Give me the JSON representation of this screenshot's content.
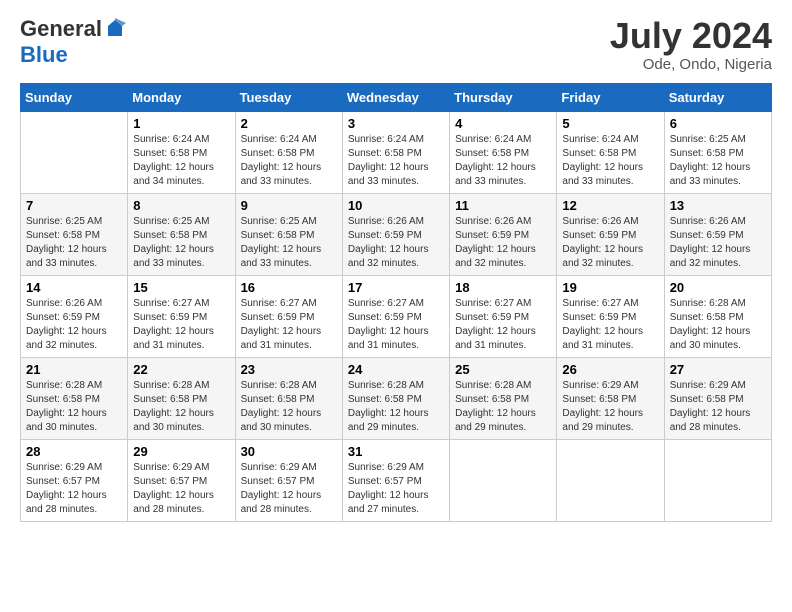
{
  "header": {
    "logo_general": "General",
    "logo_blue": "Blue",
    "month_year": "July 2024",
    "location": "Ode, Ondo, Nigeria"
  },
  "days_of_week": [
    "Sunday",
    "Monday",
    "Tuesday",
    "Wednesday",
    "Thursday",
    "Friday",
    "Saturday"
  ],
  "weeks": [
    [
      {
        "day": "",
        "sunrise": "",
        "sunset": "",
        "daylight": ""
      },
      {
        "day": "1",
        "sunrise": "Sunrise: 6:24 AM",
        "sunset": "Sunset: 6:58 PM",
        "daylight": "Daylight: 12 hours and 34 minutes."
      },
      {
        "day": "2",
        "sunrise": "Sunrise: 6:24 AM",
        "sunset": "Sunset: 6:58 PM",
        "daylight": "Daylight: 12 hours and 33 minutes."
      },
      {
        "day": "3",
        "sunrise": "Sunrise: 6:24 AM",
        "sunset": "Sunset: 6:58 PM",
        "daylight": "Daylight: 12 hours and 33 minutes."
      },
      {
        "day": "4",
        "sunrise": "Sunrise: 6:24 AM",
        "sunset": "Sunset: 6:58 PM",
        "daylight": "Daylight: 12 hours and 33 minutes."
      },
      {
        "day": "5",
        "sunrise": "Sunrise: 6:24 AM",
        "sunset": "Sunset: 6:58 PM",
        "daylight": "Daylight: 12 hours and 33 minutes."
      },
      {
        "day": "6",
        "sunrise": "Sunrise: 6:25 AM",
        "sunset": "Sunset: 6:58 PM",
        "daylight": "Daylight: 12 hours and 33 minutes."
      }
    ],
    [
      {
        "day": "7",
        "sunrise": "Sunrise: 6:25 AM",
        "sunset": "Sunset: 6:58 PM",
        "daylight": "Daylight: 12 hours and 33 minutes."
      },
      {
        "day": "8",
        "sunrise": "Sunrise: 6:25 AM",
        "sunset": "Sunset: 6:58 PM",
        "daylight": "Daylight: 12 hours and 33 minutes."
      },
      {
        "day": "9",
        "sunrise": "Sunrise: 6:25 AM",
        "sunset": "Sunset: 6:58 PM",
        "daylight": "Daylight: 12 hours and 33 minutes."
      },
      {
        "day": "10",
        "sunrise": "Sunrise: 6:26 AM",
        "sunset": "Sunset: 6:59 PM",
        "daylight": "Daylight: 12 hours and 32 minutes."
      },
      {
        "day": "11",
        "sunrise": "Sunrise: 6:26 AM",
        "sunset": "Sunset: 6:59 PM",
        "daylight": "Daylight: 12 hours and 32 minutes."
      },
      {
        "day": "12",
        "sunrise": "Sunrise: 6:26 AM",
        "sunset": "Sunset: 6:59 PM",
        "daylight": "Daylight: 12 hours and 32 minutes."
      },
      {
        "day": "13",
        "sunrise": "Sunrise: 6:26 AM",
        "sunset": "Sunset: 6:59 PM",
        "daylight": "Daylight: 12 hours and 32 minutes."
      }
    ],
    [
      {
        "day": "14",
        "sunrise": "Sunrise: 6:26 AM",
        "sunset": "Sunset: 6:59 PM",
        "daylight": "Daylight: 12 hours and 32 minutes."
      },
      {
        "day": "15",
        "sunrise": "Sunrise: 6:27 AM",
        "sunset": "Sunset: 6:59 PM",
        "daylight": "Daylight: 12 hours and 31 minutes."
      },
      {
        "day": "16",
        "sunrise": "Sunrise: 6:27 AM",
        "sunset": "Sunset: 6:59 PM",
        "daylight": "Daylight: 12 hours and 31 minutes."
      },
      {
        "day": "17",
        "sunrise": "Sunrise: 6:27 AM",
        "sunset": "Sunset: 6:59 PM",
        "daylight": "Daylight: 12 hours and 31 minutes."
      },
      {
        "day": "18",
        "sunrise": "Sunrise: 6:27 AM",
        "sunset": "Sunset: 6:59 PM",
        "daylight": "Daylight: 12 hours and 31 minutes."
      },
      {
        "day": "19",
        "sunrise": "Sunrise: 6:27 AM",
        "sunset": "Sunset: 6:59 PM",
        "daylight": "Daylight: 12 hours and 31 minutes."
      },
      {
        "day": "20",
        "sunrise": "Sunrise: 6:28 AM",
        "sunset": "Sunset: 6:58 PM",
        "daylight": "Daylight: 12 hours and 30 minutes."
      }
    ],
    [
      {
        "day": "21",
        "sunrise": "Sunrise: 6:28 AM",
        "sunset": "Sunset: 6:58 PM",
        "daylight": "Daylight: 12 hours and 30 minutes."
      },
      {
        "day": "22",
        "sunrise": "Sunrise: 6:28 AM",
        "sunset": "Sunset: 6:58 PM",
        "daylight": "Daylight: 12 hours and 30 minutes."
      },
      {
        "day": "23",
        "sunrise": "Sunrise: 6:28 AM",
        "sunset": "Sunset: 6:58 PM",
        "daylight": "Daylight: 12 hours and 30 minutes."
      },
      {
        "day": "24",
        "sunrise": "Sunrise: 6:28 AM",
        "sunset": "Sunset: 6:58 PM",
        "daylight": "Daylight: 12 hours and 29 minutes."
      },
      {
        "day": "25",
        "sunrise": "Sunrise: 6:28 AM",
        "sunset": "Sunset: 6:58 PM",
        "daylight": "Daylight: 12 hours and 29 minutes."
      },
      {
        "day": "26",
        "sunrise": "Sunrise: 6:29 AM",
        "sunset": "Sunset: 6:58 PM",
        "daylight": "Daylight: 12 hours and 29 minutes."
      },
      {
        "day": "27",
        "sunrise": "Sunrise: 6:29 AM",
        "sunset": "Sunset: 6:58 PM",
        "daylight": "Daylight: 12 hours and 28 minutes."
      }
    ],
    [
      {
        "day": "28",
        "sunrise": "Sunrise: 6:29 AM",
        "sunset": "Sunset: 6:57 PM",
        "daylight": "Daylight: 12 hours and 28 minutes."
      },
      {
        "day": "29",
        "sunrise": "Sunrise: 6:29 AM",
        "sunset": "Sunset: 6:57 PM",
        "daylight": "Daylight: 12 hours and 28 minutes."
      },
      {
        "day": "30",
        "sunrise": "Sunrise: 6:29 AM",
        "sunset": "Sunset: 6:57 PM",
        "daylight": "Daylight: 12 hours and 28 minutes."
      },
      {
        "day": "31",
        "sunrise": "Sunrise: 6:29 AM",
        "sunset": "Sunset: 6:57 PM",
        "daylight": "Daylight: 12 hours and 27 minutes."
      },
      {
        "day": "",
        "sunrise": "",
        "sunset": "",
        "daylight": ""
      },
      {
        "day": "",
        "sunrise": "",
        "sunset": "",
        "daylight": ""
      },
      {
        "day": "",
        "sunrise": "",
        "sunset": "",
        "daylight": ""
      }
    ]
  ]
}
